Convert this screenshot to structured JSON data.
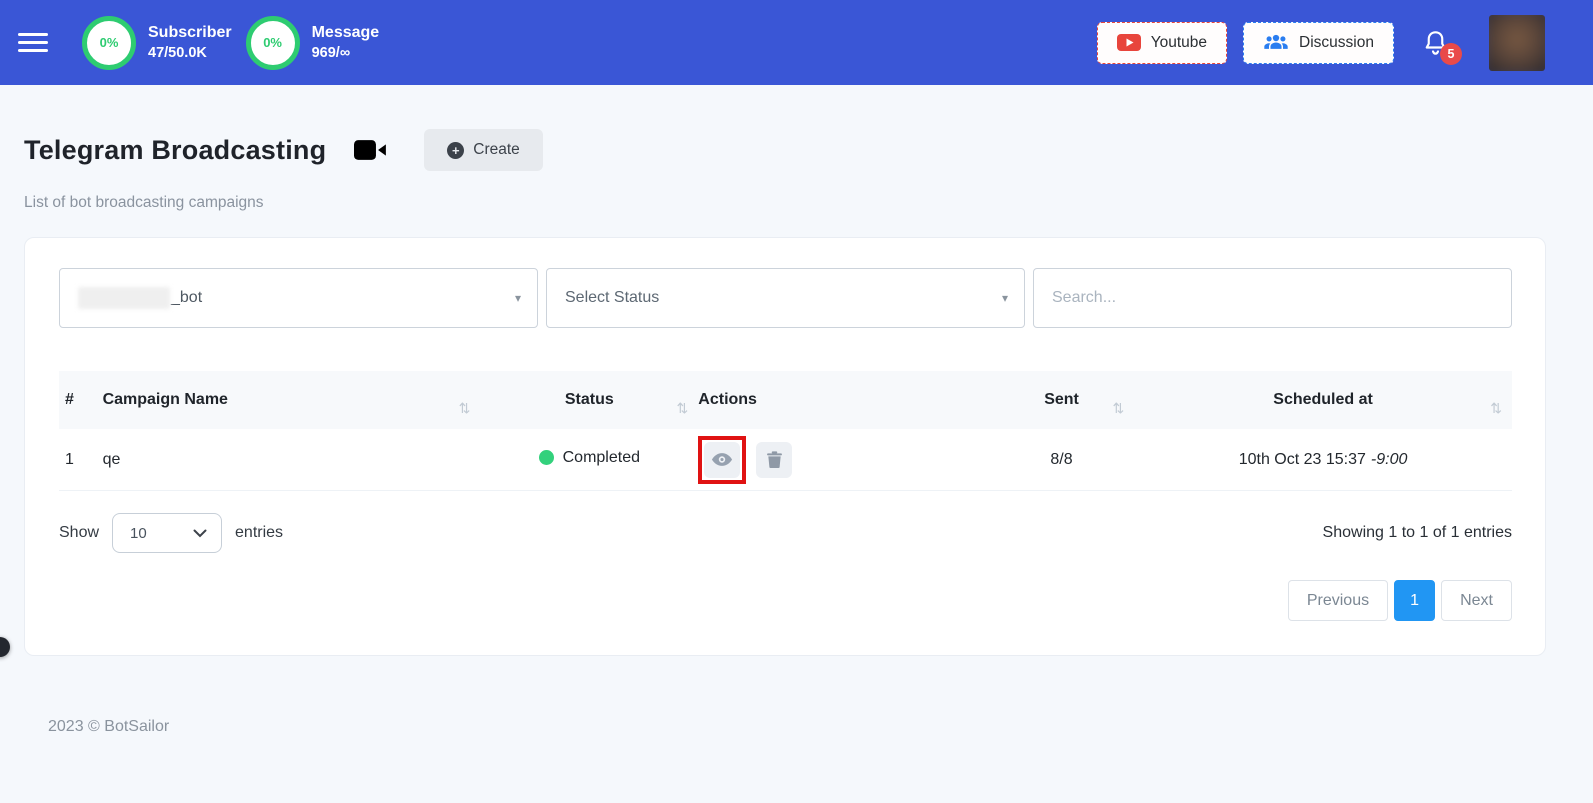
{
  "header": {
    "stats": [
      {
        "percent": "0%",
        "label": "Subscriber",
        "value": "47/50.0K"
      },
      {
        "percent": "0%",
        "label": "Message",
        "value": "969/∞"
      }
    ],
    "youtube_label": "Youtube",
    "discussion_label": "Discussion",
    "notification_count": "5"
  },
  "page": {
    "title": "Telegram Broadcasting",
    "create_label": "Create",
    "subtitle": "List of bot broadcasting campaigns"
  },
  "filters": {
    "bot_select_value": "_bot",
    "status_select_value": "Select Status",
    "search_placeholder": "Search..."
  },
  "table": {
    "columns": [
      "#",
      "Campaign Name",
      "Status",
      "Actions",
      "Sent",
      "Scheduled at"
    ],
    "rows": [
      {
        "index": "1",
        "name": "qe",
        "status": "Completed",
        "sent": "8/8",
        "scheduled_date": "10th Oct 23 15:37",
        "scheduled_offset": "-9:00"
      }
    ]
  },
  "table_footer": {
    "show_label": "Show",
    "entries_per_page": "10",
    "entries_label": "entries",
    "showing_text": "Showing 1 to 1 of 1 entries"
  },
  "pagination": {
    "previous": "Previous",
    "current_page": "1",
    "next": "Next"
  },
  "footer": {
    "copyright": "2023 © BotSailor"
  },
  "icons": {
    "sort": "⇅",
    "caret": "▾",
    "plus": "+"
  },
  "colors": {
    "topbar_blue": "#3a56d6",
    "progress_green": "#2ecc71",
    "status_green": "#33d17c",
    "notification_red": "#e94a4a",
    "youtube_red": "#e8453c",
    "discussion_blue": "#2a7df0",
    "active_page_blue": "#2196f3",
    "annotation_red": "#e01212"
  }
}
